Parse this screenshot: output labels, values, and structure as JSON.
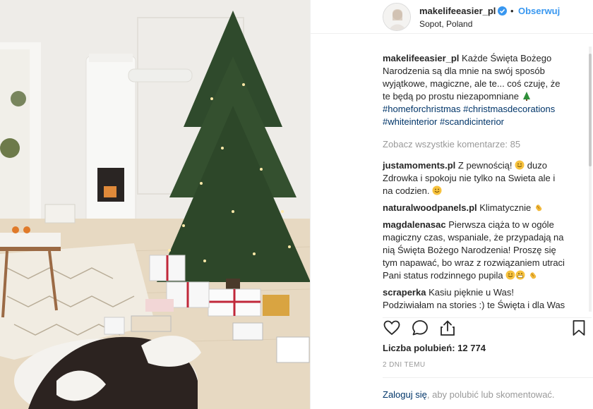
{
  "post": {
    "username": "makelifeeasier_pl",
    "follow_label": "Obserwuj",
    "separator": "•",
    "location": "Sopot, Poland",
    "caption": {
      "username": "makelifeeasier_pl",
      "text": "Każde Święta Bożego Narodzenia są dla mnie na swój sposób wyjątkowe, magiczne, ale te... coś czuję, że te będą po prostu niezapomniane",
      "emoji_icon": "christmas-tree-emoji",
      "hashtags": [
        "#homeforchristmas",
        "#christmasdecorations",
        "#whiteinterior",
        "#scandicinterior"
      ]
    },
    "view_all_comments": "Zobacz wszystkie komentarze: 85",
    "comments": [
      {
        "username": "justamoments.pl",
        "text_1": "Z pewnością!",
        "text_2": "duzo Zdrowka i spokoju nie tylko na Swieta ale i na codzien.",
        "emojis": [
          "smile-emoji",
          "smile-emoji"
        ]
      },
      {
        "username": "naturalwoodpanels.pl",
        "text": "Klimatycznie",
        "emojis": [
          "clapping-hands-emoji"
        ]
      },
      {
        "username": "magdalenasac",
        "text": "Pierwsza ciąża to w ogóle magiczny czas, wspaniale, że przypadają na nią Święta Bożego Narodzenia! Proszę się tym napawać, bo wraz z rozwiązaniem utraci Pani status rodzinnego pupila",
        "emojis": [
          "smile-emoji",
          "grin-emoji",
          "clapping-hands-emoji"
        ]
      },
      {
        "username": "scraperka",
        "text": "Kasiu pięknie u Was!",
        "text_cut": "Podziwiałam na stories :) te Święta i dla Was"
      }
    ],
    "likes": "Liczba polubień: 12 774",
    "timestamp": "2 DNI TEMU",
    "footer": {
      "login_link": "Zaloguj się",
      "rest": ", aby polubić lub skomentować."
    },
    "icons": {
      "like": "heart-icon",
      "comment": "comment-icon",
      "share": "share-icon",
      "save": "bookmark-icon",
      "verified": "verified-badge-icon"
    },
    "colors": {
      "link_blue": "#3897f0",
      "hashtag": "#003569",
      "muted": "#999999",
      "verified": "#3897f0"
    }
  }
}
